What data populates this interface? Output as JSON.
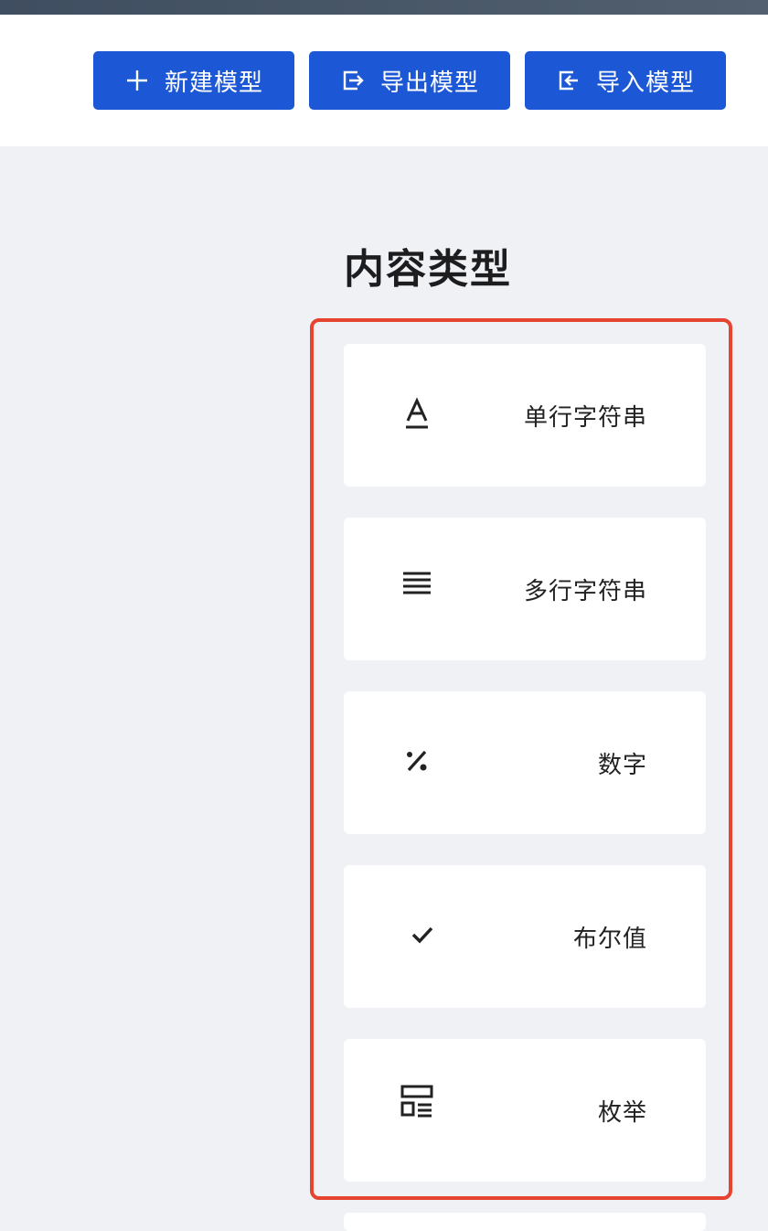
{
  "toolbar": {
    "new_model_label": "新建模型",
    "export_model_label": "导出模型",
    "import_model_label": "导入模型"
  },
  "content_types": {
    "title": "内容类型",
    "items": [
      {
        "label": "单行字符串",
        "icon": "text-a-underline-icon"
      },
      {
        "label": "多行字符串",
        "icon": "multiline-text-icon"
      },
      {
        "label": "数字",
        "icon": "percent-icon"
      },
      {
        "label": "布尔值",
        "icon": "checkmark-icon"
      },
      {
        "label": "枚举",
        "icon": "enum-list-icon"
      }
    ]
  },
  "colors": {
    "primary": "#1c57d6",
    "highlight_border": "#e64331",
    "background": "#f0f1f4"
  }
}
